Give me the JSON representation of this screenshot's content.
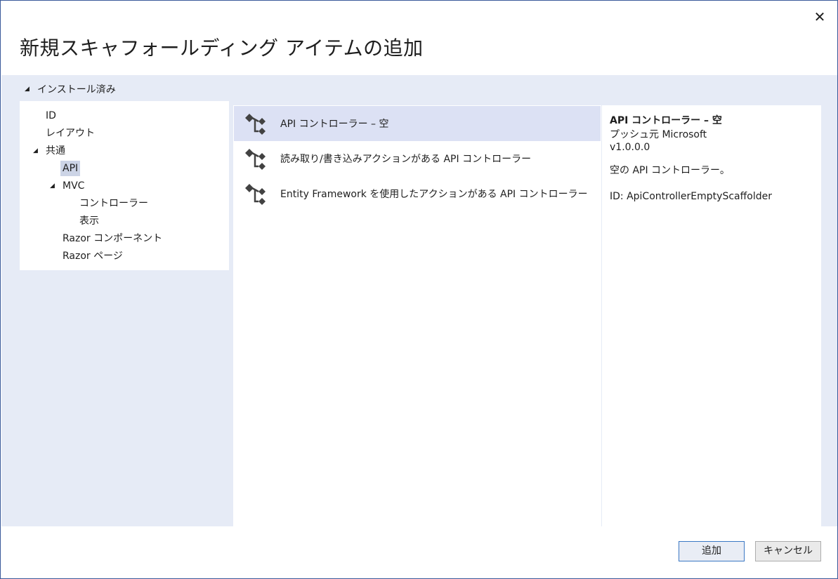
{
  "dialog": {
    "title": "新規スキャフォールディング アイテムの追加",
    "close_glyph": "✕"
  },
  "installed": {
    "header": "インストール済み"
  },
  "tree": {
    "items": [
      {
        "label": "ID"
      },
      {
        "label": "レイアウト"
      },
      {
        "label": "共通"
      },
      {
        "label": "API"
      },
      {
        "label": "MVC"
      },
      {
        "label": "コントローラー"
      },
      {
        "label": "表示"
      },
      {
        "label": "Razor コンポーネント"
      },
      {
        "label": "Razor ページ"
      }
    ],
    "selected": "API",
    "expander_glyph": "◢"
  },
  "templates": {
    "items": [
      {
        "label": "API コントローラー – 空",
        "icon": "scaffold-icon"
      },
      {
        "label": "読み取り/書き込みアクションがある API コントローラー",
        "icon": "scaffold-icon"
      },
      {
        "label": "Entity Framework を使用したアクションがある API コントローラー",
        "icon": "scaffold-icon"
      }
    ],
    "selected_index": 0
  },
  "details": {
    "title": "API コントローラー – 空",
    "publisher": "プッシュ元 Microsoft",
    "version": "v1.0.0.0",
    "description": "空の API コントローラー。",
    "id": "ID: ApiControllerEmptyScaffolder"
  },
  "buttons": {
    "add": "追加",
    "cancel": "キャンセル"
  }
}
